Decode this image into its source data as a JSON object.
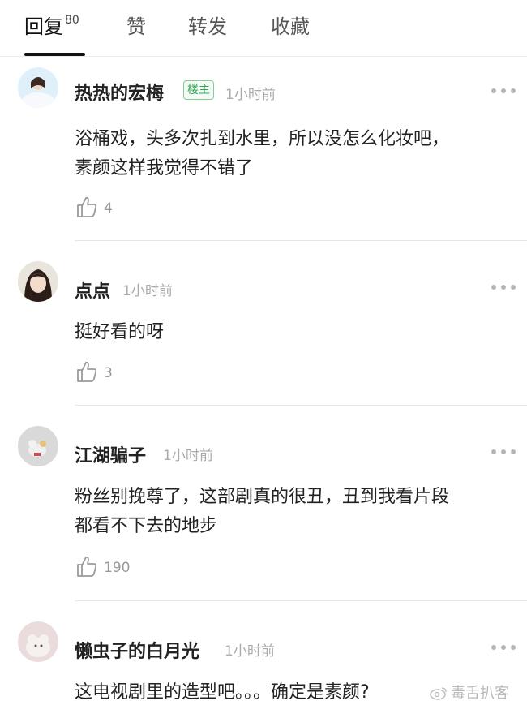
{
  "tabs": [
    {
      "label": "回复",
      "count": "80"
    },
    {
      "label": "赞"
    },
    {
      "label": "转发"
    },
    {
      "label": "收藏"
    }
  ],
  "comments": [
    {
      "user": "热热的宏梅",
      "badge": "楼主",
      "time": "1小时前",
      "text_line1": "浴桶戏，头多次扎到水里，所以没怎么化妆吧，",
      "text_line2": "素颜这样我觉得不错了",
      "likes": "4"
    },
    {
      "user": "点点",
      "time": "1小时前",
      "text_line1": "挺好看的呀",
      "likes": "3"
    },
    {
      "user": "江湖骗子",
      "time": "1小时前",
      "text_line1": "粉丝别挽尊了，这部剧真的很丑，丑到我看片段",
      "text_line2": "都看不下去的地步",
      "likes": "190"
    },
    {
      "user": "懒虫子的白月光",
      "time": "1小时前",
      "text_line1": "这电视剧里的造型吧。。。确定是素颜?"
    }
  ],
  "watermark": "毒舌扒客",
  "colors": {
    "badge_green": "#2ea44f",
    "tab_active": "#111111",
    "muted": "#aaaaaa"
  },
  "icons": [
    "more-options-icon",
    "thumbs-up-icon",
    "weibo-logo-icon"
  ]
}
